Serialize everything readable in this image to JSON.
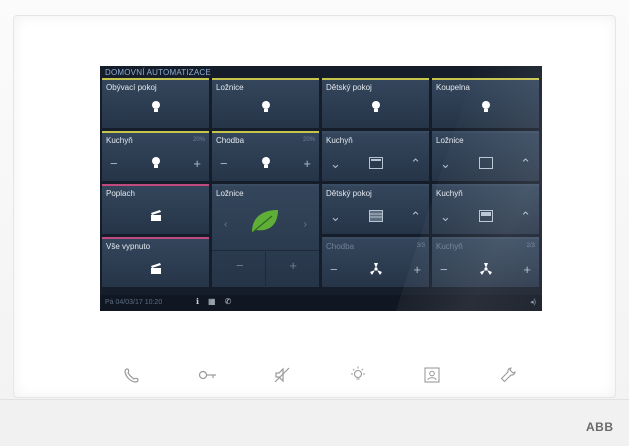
{
  "screen_title": "DOMOVNÍ AUTOMATIZACE",
  "tiles": [
    {
      "label": "Obývací pokoj"
    },
    {
      "label": "Ložnice"
    },
    {
      "label": "Dětský pokoj"
    },
    {
      "label": "Koupelna"
    },
    {
      "label": "Kuchyň",
      "value": "20%"
    },
    {
      "label": "Chodba",
      "value": "20%"
    },
    {
      "label": "Kuchyň"
    },
    {
      "label": "Ložnice"
    },
    {
      "label": "Poplach"
    },
    {
      "label": "Ložnice"
    },
    {
      "label": "Dětský pokoj"
    },
    {
      "label": "Kuchyň"
    },
    {
      "label": "Vše vypnuto"
    },
    {
      "label": "Chodba",
      "value": "3/3"
    },
    {
      "label": "Kuchyň",
      "value": "2/3"
    }
  ],
  "status": {
    "datetime": "Pá 04/03/17 10:20"
  },
  "icons": {
    "light": "bulb-icon",
    "scene": "clapperboard-icon",
    "eco": "leaf-icon",
    "blind": "blind-icon",
    "fan": "fan-icon",
    "info": "info-icon",
    "door": "door-icon",
    "call": "phone-icon"
  },
  "home_buttons": [
    "phone-icon",
    "key-icon",
    "mute-icon",
    "light-icon",
    "contact-icon",
    "wrench-icon"
  ],
  "brand": "ABB",
  "colors": {
    "accent_yellow": "#c5c44d",
    "accent_pink": "#c04a7e",
    "leaf": "#5fae38"
  }
}
